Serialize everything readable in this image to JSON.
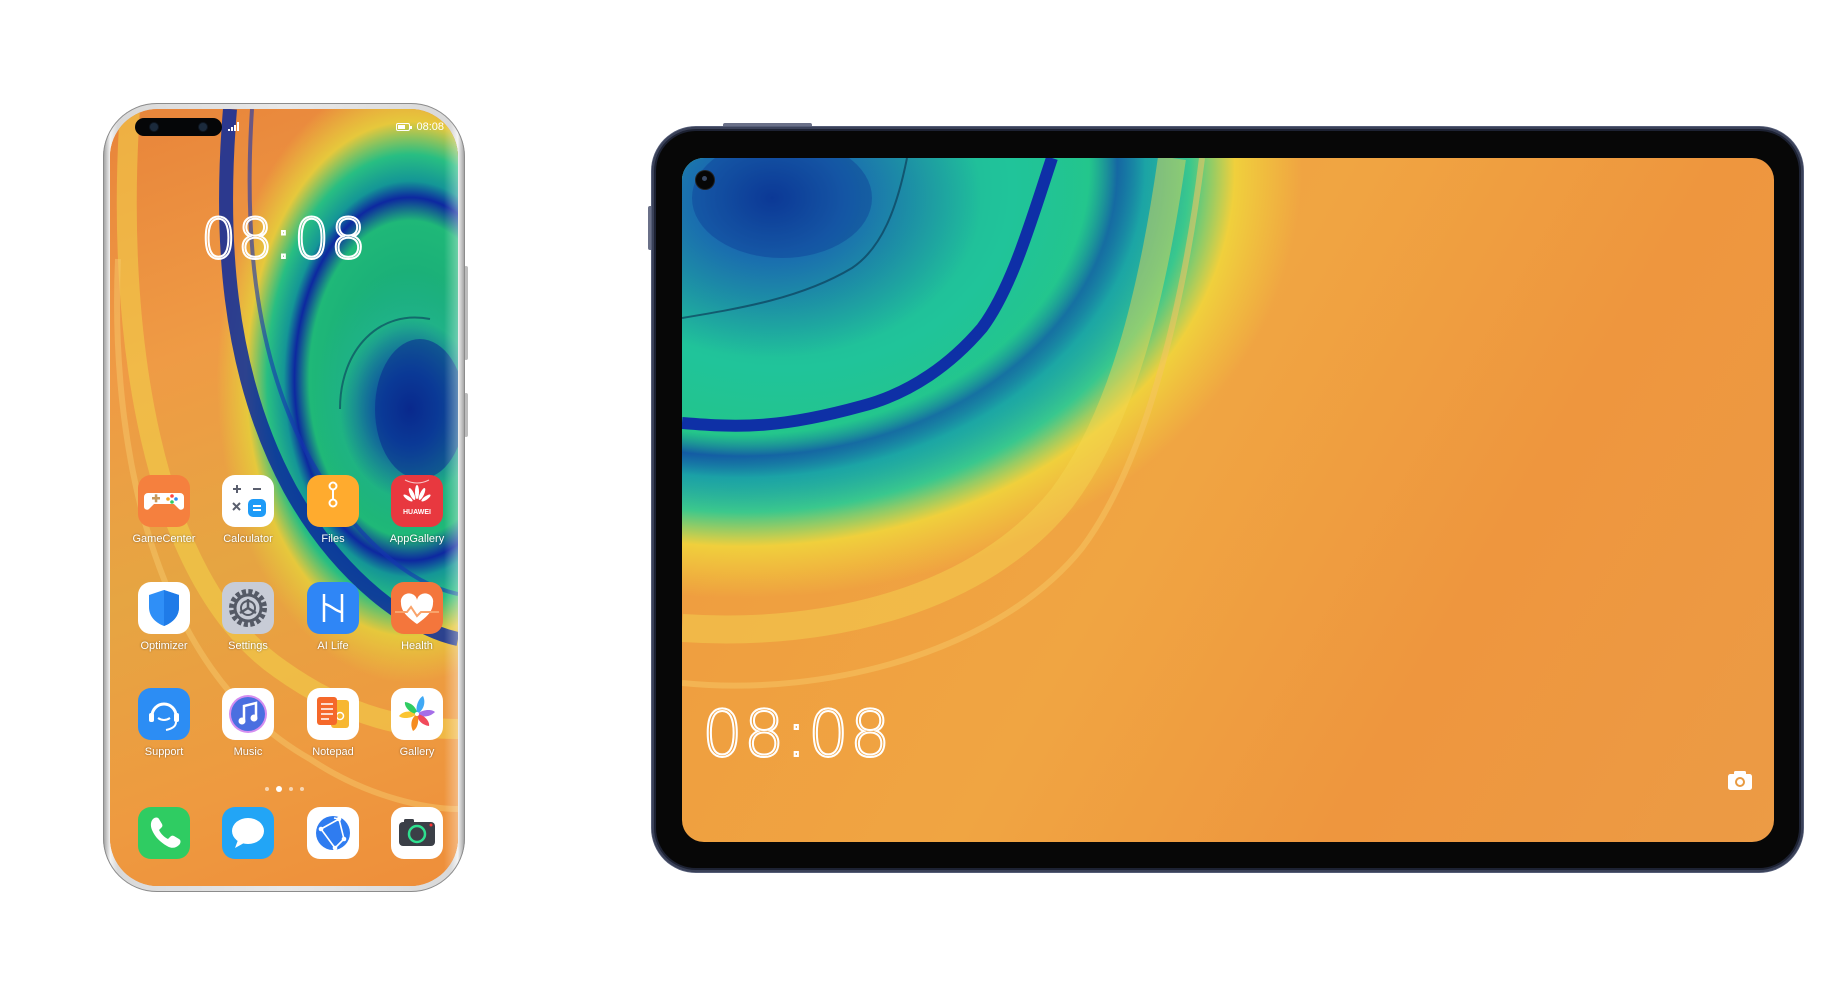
{
  "phone": {
    "status_bar": {
      "signal_icon": "signal-icon",
      "battery_icon": "battery-icon",
      "time": "08:08"
    },
    "clock": "08:08",
    "apps": [
      {
        "label": "GameCenter",
        "icon": "gamepad-icon",
        "color": "#f5803e"
      },
      {
        "label": "Calculator",
        "icon": "calculator-icon",
        "color": "#ffffff"
      },
      {
        "label": "Files",
        "icon": "folder-icon",
        "color": "#ffab2e"
      },
      {
        "label": "AppGallery",
        "icon": "huawei-icon",
        "color": "#e8383f"
      },
      {
        "label": "Optimizer",
        "icon": "shield-icon",
        "color": "#ffffff"
      },
      {
        "label": "Settings",
        "icon": "gear-icon",
        "color": "#c8ccd6"
      },
      {
        "label": "AI Life",
        "icon": "ai-life-icon",
        "color": "#2f86f6"
      },
      {
        "label": "Health",
        "icon": "heart-icon",
        "color": "#f4763c"
      },
      {
        "label": "Support",
        "icon": "headset-icon",
        "color": "#2c8df4"
      },
      {
        "label": "Music",
        "icon": "music-note-icon",
        "color": "#ffffff"
      },
      {
        "label": "Notepad",
        "icon": "notepad-icon",
        "color": "#ffffff"
      },
      {
        "label": "Gallery",
        "icon": "pinwheel-icon",
        "color": "#ffffff"
      }
    ],
    "page_indicator": {
      "pages": 4,
      "active": 2
    },
    "dock": [
      {
        "name": "phone",
        "icon": "phone-icon",
        "color": "#2fcc62"
      },
      {
        "name": "messages",
        "icon": "message-bubble-icon",
        "color": "#22a5f6"
      },
      {
        "name": "browser",
        "icon": "globe-icon",
        "color": "#ffffff"
      },
      {
        "name": "camera",
        "icon": "camera-icon",
        "color": "#ffffff"
      }
    ],
    "huawei_text": "HUAWEI"
  },
  "tablet": {
    "clock": "08:08",
    "camera_shortcut_icon": "camera-icon"
  }
}
